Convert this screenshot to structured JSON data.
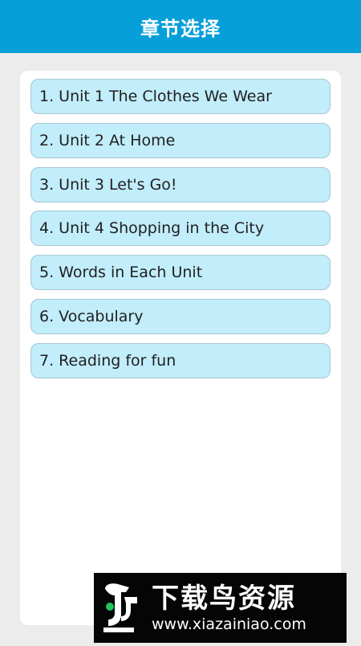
{
  "header": {
    "title": "章节选择"
  },
  "chapters": [
    {
      "label": "1. Unit 1 The Clothes We Wear"
    },
    {
      "label": "2. Unit 2 At Home"
    },
    {
      "label": "3. Unit 3 Let's Go!"
    },
    {
      "label": "4. Unit 4 Shopping in the City"
    },
    {
      "label": "5. Words in Each Unit"
    },
    {
      "label": "6. Vocabulary"
    },
    {
      "label": "7. Reading for fun"
    }
  ],
  "watermark": {
    "title": "下载鸟资源",
    "url": "www.xiazainiao.com",
    "logo_icon": "bird-logo-icon"
  },
  "colors": {
    "header_bg": "#079fd9",
    "item_bg": "#c2edfb",
    "item_border": "#a6c7d3",
    "page_bg": "#ececec",
    "logo_accent": "#22c35e"
  }
}
